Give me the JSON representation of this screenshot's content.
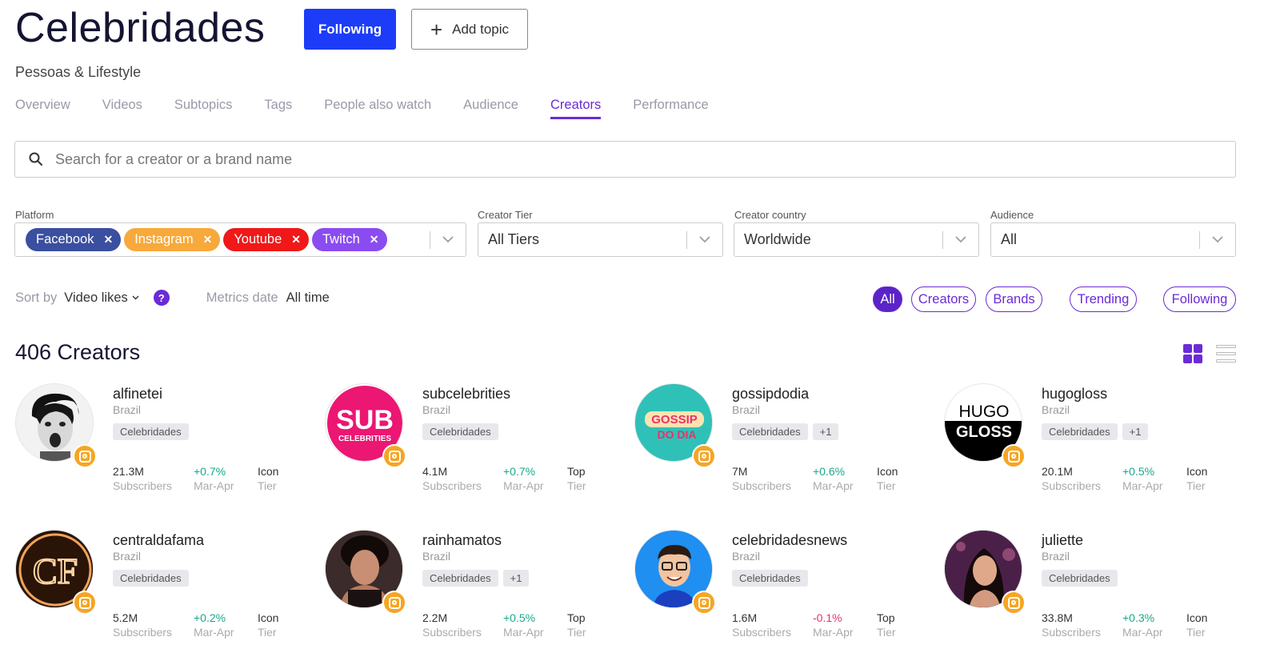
{
  "header": {
    "title": "Celebridades",
    "following_label": "Following",
    "add_topic_label": "Add topic",
    "subtitle": "Pessoas & Lifestyle"
  },
  "tabs": [
    {
      "label": "Overview",
      "active": false
    },
    {
      "label": "Videos",
      "active": false
    },
    {
      "label": "Subtopics",
      "active": false
    },
    {
      "label": "Tags",
      "active": false
    },
    {
      "label": "People also watch",
      "active": false
    },
    {
      "label": "Audience",
      "active": false
    },
    {
      "label": "Creators",
      "active": true
    },
    {
      "label": "Performance",
      "active": false
    }
  ],
  "search": {
    "placeholder": "Search for a creator or a brand name"
  },
  "filters": {
    "platform_label": "Platform",
    "platform_chips": [
      {
        "label": "Facebook",
        "color": "#3b4fa0"
      },
      {
        "label": "Instagram",
        "color": "#f7a93b"
      },
      {
        "label": "Youtube",
        "color": "#f01818"
      },
      {
        "label": "Twitch",
        "color": "#8a4cf0"
      }
    ],
    "tier_label": "Creator Tier",
    "tier_value": "All Tiers",
    "country_label": "Creator country",
    "country_value": "Worldwide",
    "audience_label": "Audience",
    "audience_value": "All"
  },
  "sort": {
    "sort_by_label": "Sort by",
    "sort_by_value": "Video likes",
    "help": "?",
    "metrics_date_label": "Metrics date",
    "metrics_date_value": "All time"
  },
  "type_filters": [
    {
      "label": "All",
      "active": true
    },
    {
      "label": "Creators",
      "active": false
    },
    {
      "label": "Brands",
      "active": false
    },
    {
      "label": "Trending",
      "active": false
    },
    {
      "label": "Following",
      "active": false
    }
  ],
  "creators_count": "406 Creators",
  "creators": [
    {
      "name": "alfinetei",
      "country": "Brazil",
      "tags": [
        "Celebridades"
      ],
      "subscribers": "21.3M",
      "subscribers_label": "Subscribers",
      "change": "+0.7%",
      "change_period": "Mar-Apr",
      "tier": "Icon",
      "tier_label": "Tier",
      "avatar": "bw-face"
    },
    {
      "name": "subcelebrities",
      "country": "Brazil",
      "tags": [
        "Celebridades"
      ],
      "subscribers": "4.1M",
      "subscribers_label": "Subscribers",
      "change": "+0.7%",
      "change_period": "Mar-Apr",
      "tier": "Top",
      "tier_label": "Tier",
      "avatar": "sub-logo"
    },
    {
      "name": "gossipdodia",
      "country": "Brazil",
      "tags": [
        "Celebridades",
        "+1"
      ],
      "subscribers": "7M",
      "subscribers_label": "Subscribers",
      "change": "+0.6%",
      "change_period": "Mar-Apr",
      "tier": "Icon",
      "tier_label": "Tier",
      "avatar": "gossip-logo"
    },
    {
      "name": "hugogloss",
      "country": "Brazil",
      "tags": [
        "Celebridades",
        "+1"
      ],
      "subscribers": "20.1M",
      "subscribers_label": "Subscribers",
      "change": "+0.5%",
      "change_period": "Mar-Apr",
      "tier": "Icon",
      "tier_label": "Tier",
      "avatar": "hugo-logo"
    },
    {
      "name": "centraldafama",
      "country": "Brazil",
      "tags": [
        "Celebridades"
      ],
      "subscribers": "5.2M",
      "subscribers_label": "Subscribers",
      "change": "+0.2%",
      "change_period": "Mar-Apr",
      "tier": "Icon",
      "tier_label": "Tier",
      "avatar": "cf-logo"
    },
    {
      "name": "rainhamatos",
      "country": "Brazil",
      "tags": [
        "Celebridades",
        "+1"
      ],
      "subscribers": "2.2M",
      "subscribers_label": "Subscribers",
      "change": "+0.5%",
      "change_period": "Mar-Apr",
      "tier": "Top",
      "tier_label": "Tier",
      "avatar": "photo-woman"
    },
    {
      "name": "celebridadesnews",
      "country": "Brazil",
      "tags": [
        "Celebridades"
      ],
      "subscribers": "1.6M",
      "subscribers_label": "Subscribers",
      "change": "-0.1%",
      "change_period": "Mar-Apr",
      "tier": "Top",
      "tier_label": "Tier",
      "avatar": "cartoon-man"
    },
    {
      "name": "juliette",
      "country": "Brazil",
      "tags": [
        "Celebridades"
      ],
      "subscribers": "33.8M",
      "subscribers_label": "Subscribers",
      "change": "+0.3%",
      "change_period": "Mar-Apr",
      "tier": "Icon",
      "tier_label": "Tier",
      "avatar": "photo-woman-dark"
    }
  ],
  "logos": {
    "sub_line1": "SUB",
    "sub_line2": "CELEBRITIES",
    "gossip_line1": "GOSSIP",
    "gossip_line2": "DO DIA",
    "hugo_line1": "HUGO",
    "hugo_line2": "GLOSS",
    "cf": "CF"
  }
}
